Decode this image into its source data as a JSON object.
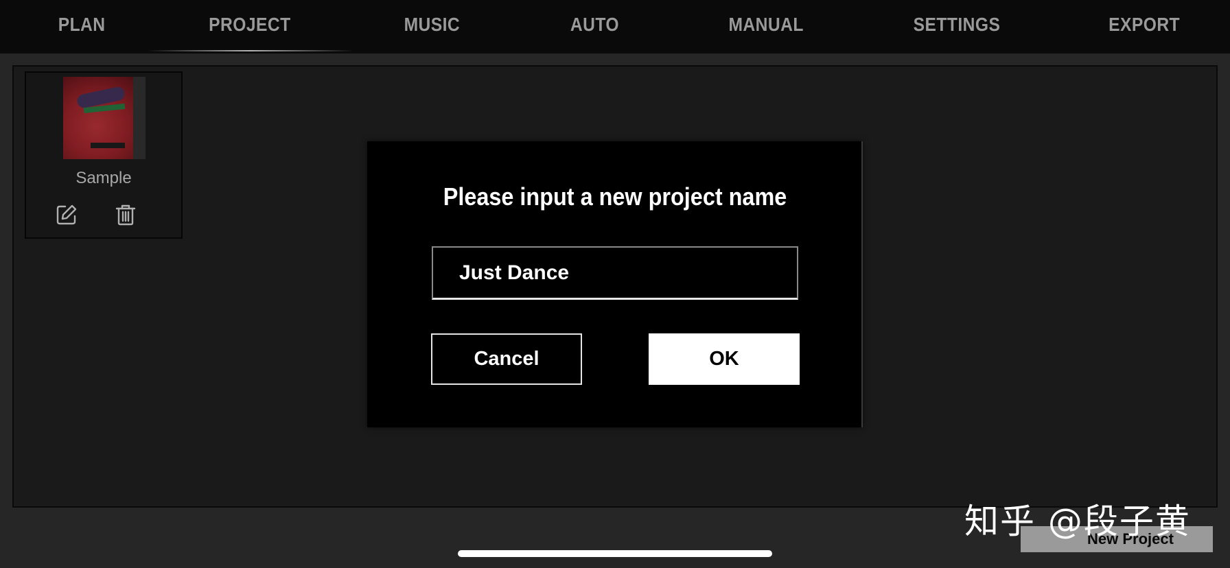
{
  "nav": {
    "tabs": [
      {
        "label": "PLAN"
      },
      {
        "label": "PROJECT",
        "active": true
      },
      {
        "label": "MUSIC"
      },
      {
        "label": "AUTO"
      },
      {
        "label": "MANUAL"
      },
      {
        "label": "SETTINGS"
      },
      {
        "label": "EXPORT"
      }
    ]
  },
  "projects": [
    {
      "name": "Sample",
      "actions": [
        "edit-icon",
        "trash-icon"
      ]
    }
  ],
  "dialog": {
    "title": "Please input a new project name",
    "input_value": "Just Dance",
    "cancel_label": "Cancel",
    "ok_label": "OK"
  },
  "footer": {
    "new_project_label": "New Project",
    "watermark": "知乎 @段子黄"
  },
  "colors": {
    "nav_bg": "#0a0a0a",
    "tab_text": "#9a9a9a",
    "panel_bg": "#1a1a1a",
    "dialog_bg": "#000000",
    "ok_bg": "#ffffff"
  }
}
